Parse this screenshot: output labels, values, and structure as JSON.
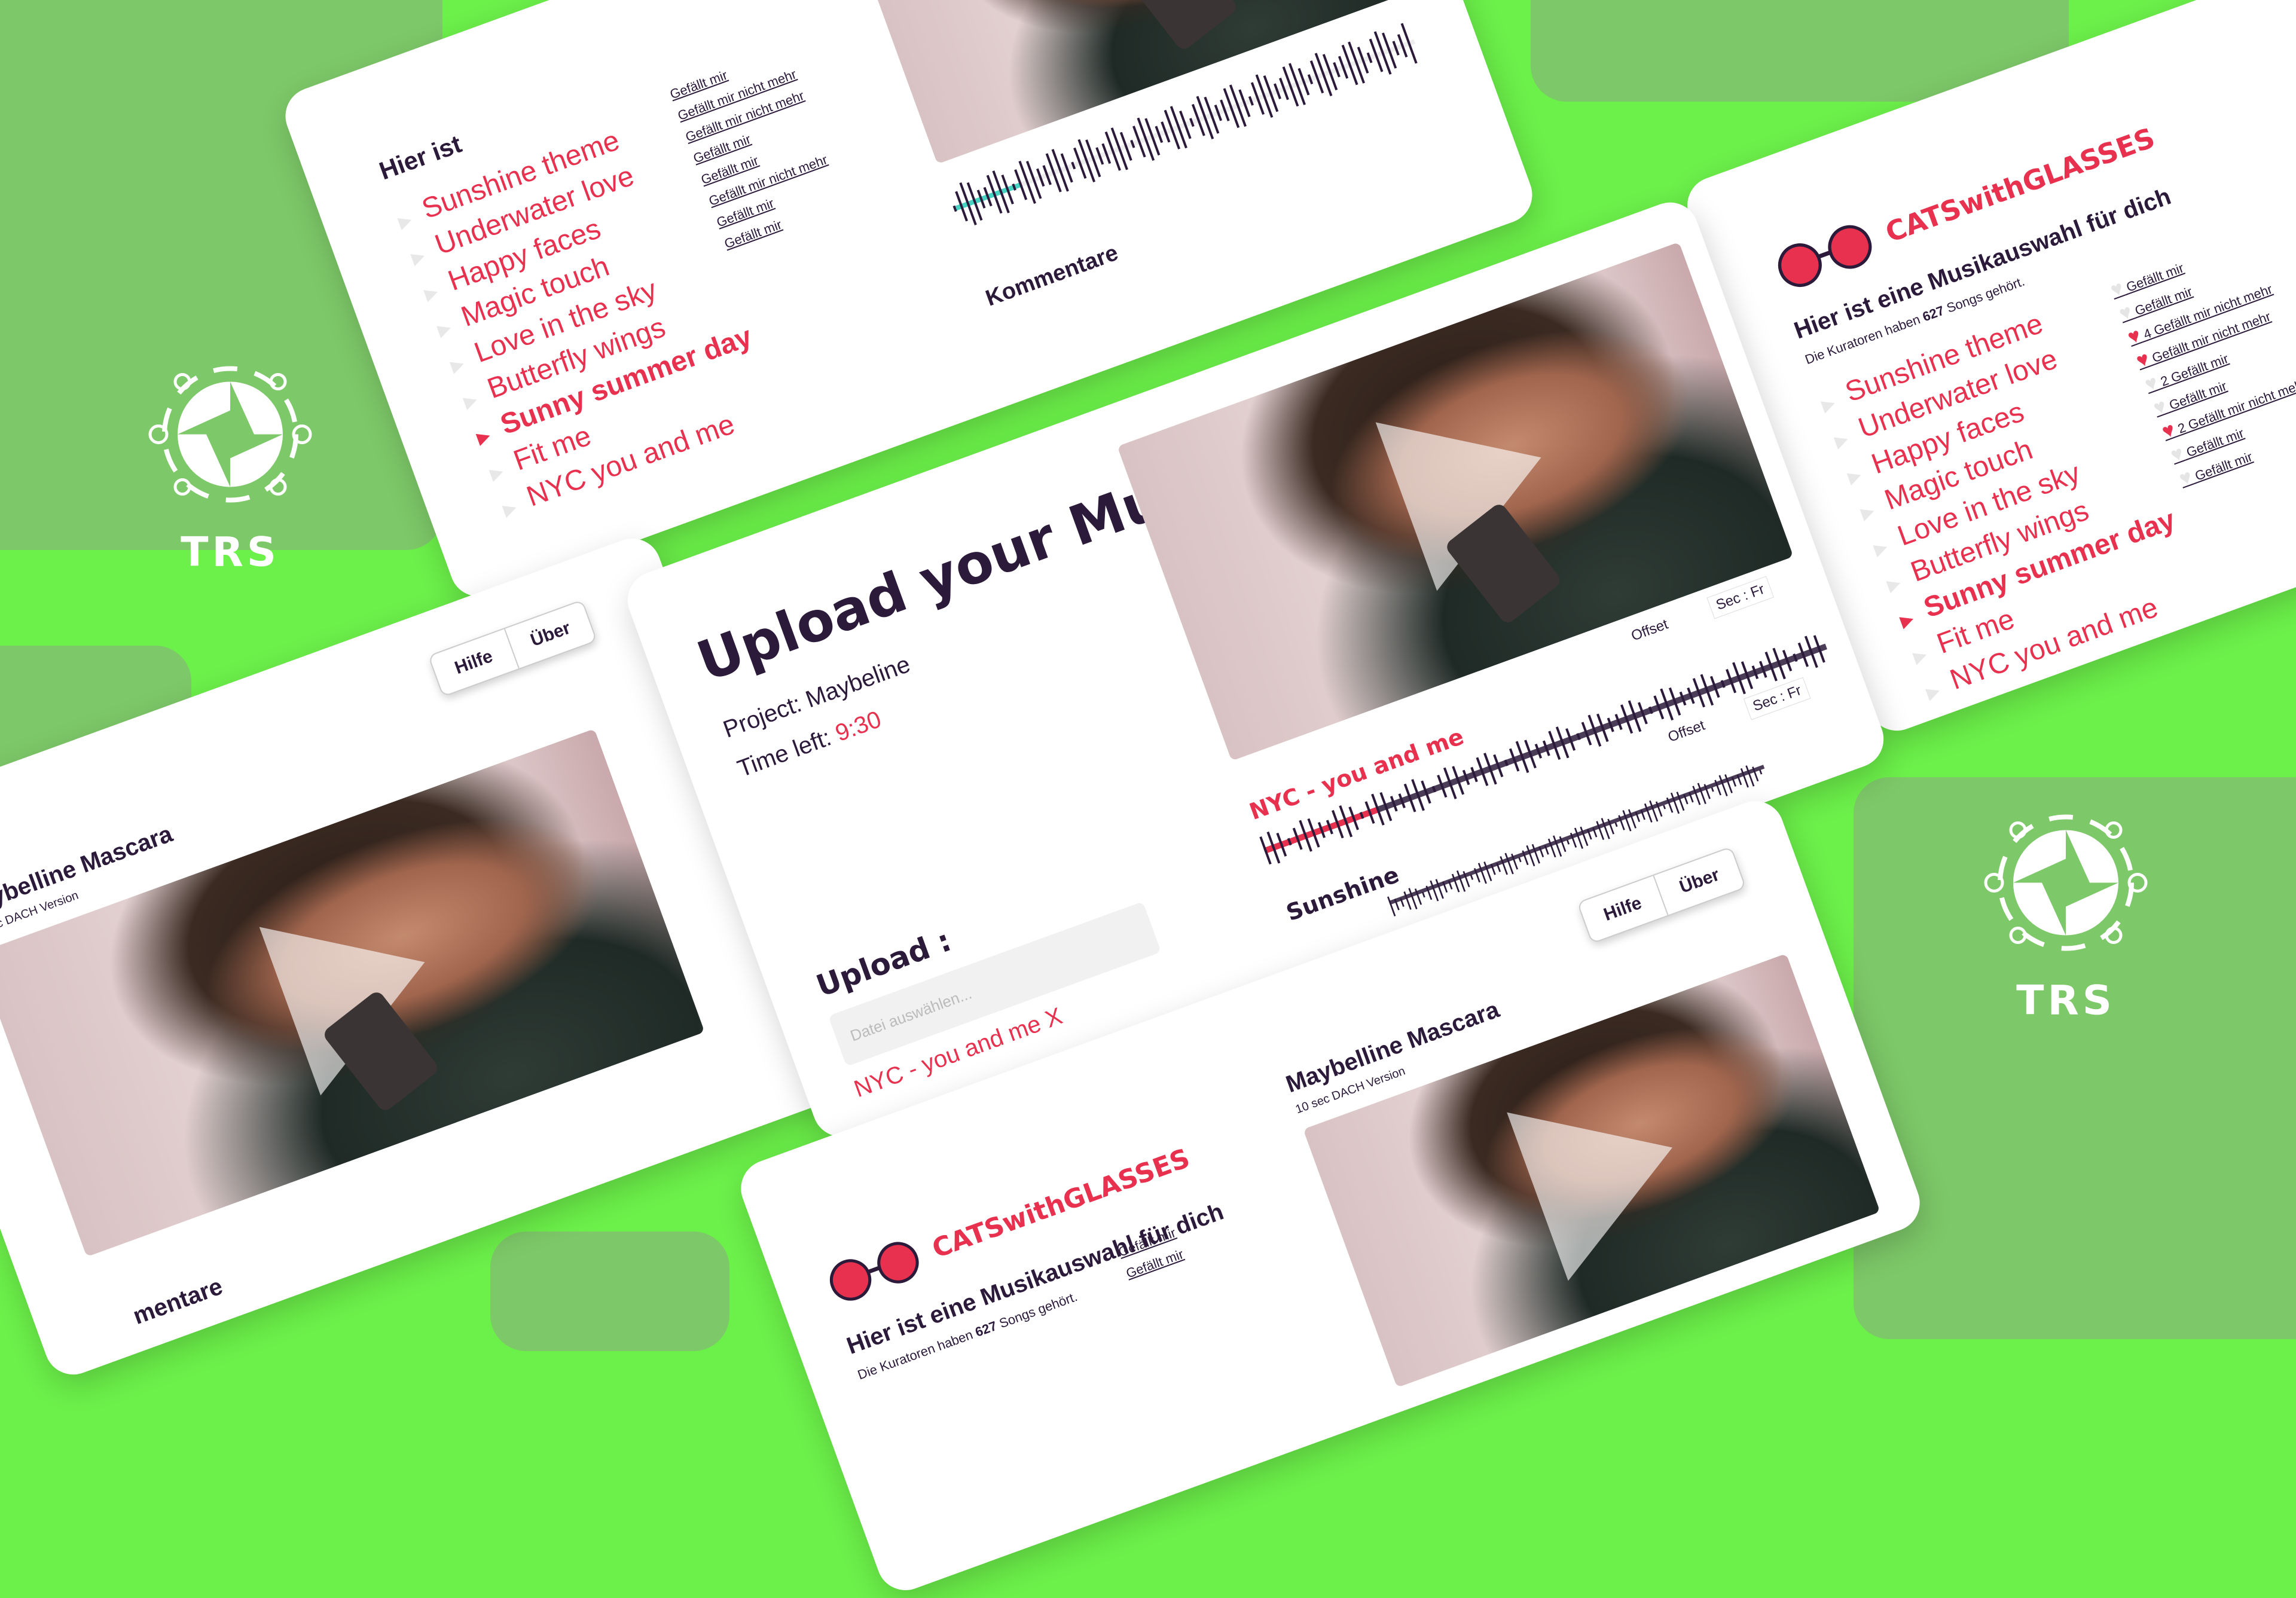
{
  "logo": {
    "text": "TRS"
  },
  "playlist": {
    "brand": "CATSwithGLASSES",
    "heading": "Hier ist eine Musikauswahl für dich",
    "heading_short": "Hier ist",
    "curators_prefix": "Die Kuratoren haben",
    "curators_count": "627",
    "curators_suffix": "Songs gehört.",
    "songs": [
      {
        "title": "Sunshine theme",
        "active": false
      },
      {
        "title": "Underwater love",
        "active": false
      },
      {
        "title": "Happy faces",
        "active": false
      },
      {
        "title": "Magic touch",
        "active": false
      },
      {
        "title": "Love in the sky",
        "active": false
      },
      {
        "title": "Butterfly wings",
        "active": false
      },
      {
        "title": "Sunny summer day",
        "active": true
      },
      {
        "title": "Fit me",
        "active": false
      },
      {
        "title": "NYC you and me",
        "active": false
      }
    ],
    "like_labels": [
      "Gefällt mir",
      "Gefällt mir",
      "Gefällt mir nicht mehr",
      "Gefällt mir nicht mehr",
      "Gefällt mir",
      "Gefällt mir",
      "Gefällt mir nicht mehr",
      "Gefällt mir",
      "Gefällt mir"
    ],
    "like_counts": [
      "",
      "",
      "4",
      "",
      "2",
      "",
      "2",
      "",
      ""
    ]
  },
  "player": {
    "title": "Maybelline Mascara",
    "subtitle": "10 sec DACH Version",
    "help": "Hilfe",
    "about": "Über",
    "comments": "Kommentare",
    "comments_partial": "mentare"
  },
  "upload": {
    "title": "Upload your Music",
    "project_label": "Project:",
    "project": "Maybeline",
    "time_label": "Time left:",
    "time": "9:30",
    "upload_label": "Upload :",
    "file_placeholder": "Datei auswählen...",
    "file_selected": "NYC - you and me X",
    "tracks": [
      {
        "name": "NYC - you and me",
        "highlight": true,
        "offset_label": "Offset",
        "sync_label": "Sec : Fr"
      },
      {
        "name": "Sunshine",
        "highlight": false,
        "offset_label": "Offset",
        "sync_label": "Sec : Fr"
      }
    ]
  }
}
